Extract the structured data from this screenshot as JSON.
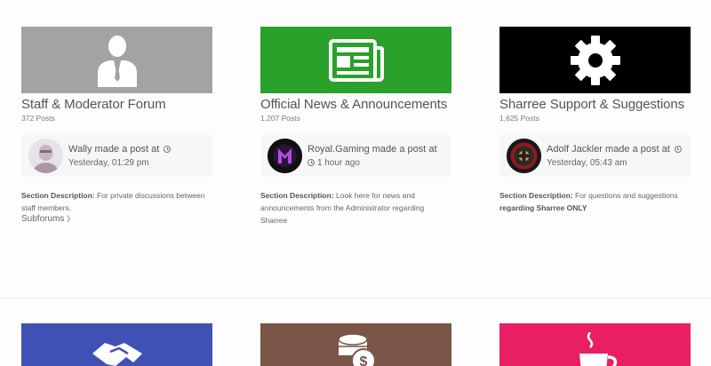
{
  "forums": [
    {
      "title": "Staff & Moderator Forum",
      "posts": "372 Posts",
      "banner_color": "#a3a3a3",
      "icon": "user-suit-icon",
      "latest_user_action": "Wally made a post at",
      "latest_time": "Yesterday, 01:29 pm",
      "desc_label": "Section Description:",
      "desc_text": " For private discussions between staff members.",
      "subforums_label": "Subforums"
    },
    {
      "title": "Official News & Announcements",
      "posts": "1,207 Posts",
      "banner_color": "#2aa12a",
      "icon": "newspaper-icon",
      "latest_user_action": "Royal.Gaming made a post at",
      "latest_time": "1 hour ago",
      "desc_label": "Section Description:",
      "desc_text": " Look here for news and announcements from the Administrator regarding Sharree"
    },
    {
      "title": "Sharree Support & Suggestions",
      "posts": "1,625 Posts",
      "banner_color": "#000000",
      "icon": "gear-icon",
      "latest_user_action": "Adolf Jackler made a post at",
      "latest_time": "Yesterday, 05:43 am",
      "desc_label": "Section Description:",
      "desc_text": " For questions and suggestions ",
      "desc_bold_tail": "regarding Sharree ONLY"
    }
  ],
  "row2": [
    {
      "banner_color": "#3f51b5",
      "icon": "handshake-icon"
    },
    {
      "banner_color": "#795548",
      "icon": "coins-icon"
    },
    {
      "banner_color": "#e91e63",
      "icon": "coffee-cup-icon"
    }
  ]
}
